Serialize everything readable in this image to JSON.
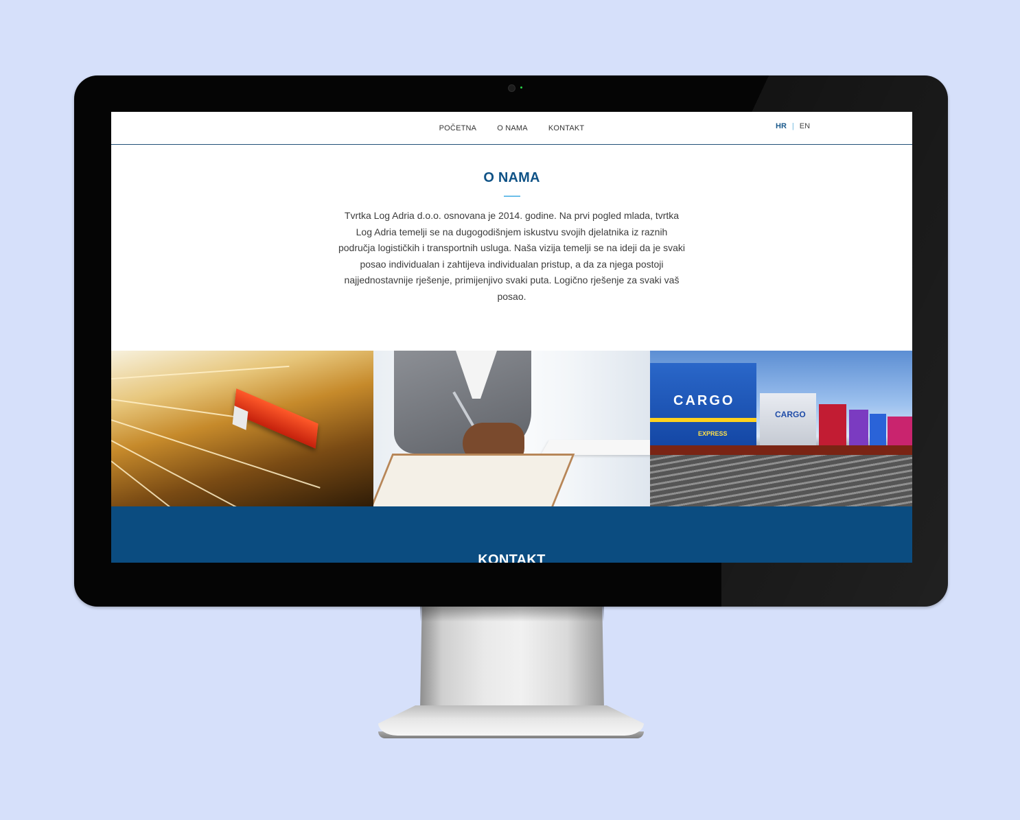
{
  "nav": {
    "links": [
      "POČETNA",
      "O NAMA",
      "KONTAKT"
    ],
    "lang_active": "HR",
    "lang_sep": "|",
    "lang_other": "EN"
  },
  "about": {
    "title": "O NAMA",
    "text": "Tvrtka Log Adria d.o.o. osnovana je 2014. godine. Na prvi pogled mlada, tvrtka Log Adria temelji se na dugogodišnjem iskustvu svojih djelatnika iz raznih područja logističkih i transportnih usluga. Naša vizija temelji se na ideji da je svaki posao individualan i zahtijeva individualan pristup, a da za njega postoji najjednostavnije rješenje, primijenjivo svaki puta. Logično rješenje za svaki vaš posao."
  },
  "photos": {
    "cargo_logo": "CARGO",
    "cargo_sub": "EXPRESS",
    "cargo_logo_small": "CARGO"
  },
  "contact": {
    "title": "KONTAKT"
  }
}
